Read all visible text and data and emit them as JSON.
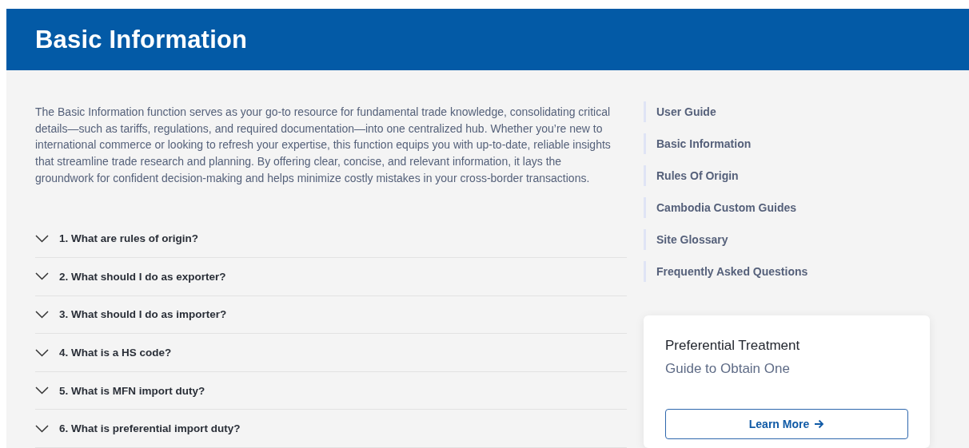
{
  "header": {
    "title": "Basic Information"
  },
  "intro": "The Basic Information function serves as your go-to resource for fundamental trade knowledge, consolidating critical details—such as tariffs, regulations, and required documentation—into one centralized hub. Whether you’re new to international commerce or looking to refresh your expertise, this function equips you with up-to-date, reliable insights that streamline trade research and planning. By offering clear, concise, and relevant information, it lays the groundwork for confident decision-making and helps minimize costly mistakes in your cross-border transactions.",
  "faq": [
    {
      "question": "1. What are rules of origin?",
      "expanded": false
    },
    {
      "question": "2. What should I do as exporter?",
      "expanded": false
    },
    {
      "question": "3. What should I do as importer?",
      "expanded": false
    },
    {
      "question": "4. What is a HS code?",
      "expanded": false
    },
    {
      "question": "5. What is MFN import duty?",
      "expanded": false
    },
    {
      "question": "6. What is preferential import duty?",
      "expanded": false
    }
  ],
  "sidebar": {
    "items": [
      "User Guide",
      "Basic Information",
      "Rules Of Origin",
      "Cambodia Custom Guides",
      "Site Glossary",
      "Frequently Asked Questions"
    ]
  },
  "card": {
    "title": "Preferential Treatment",
    "subtitle": "Guide to Obtain One",
    "button": "Learn More"
  }
}
